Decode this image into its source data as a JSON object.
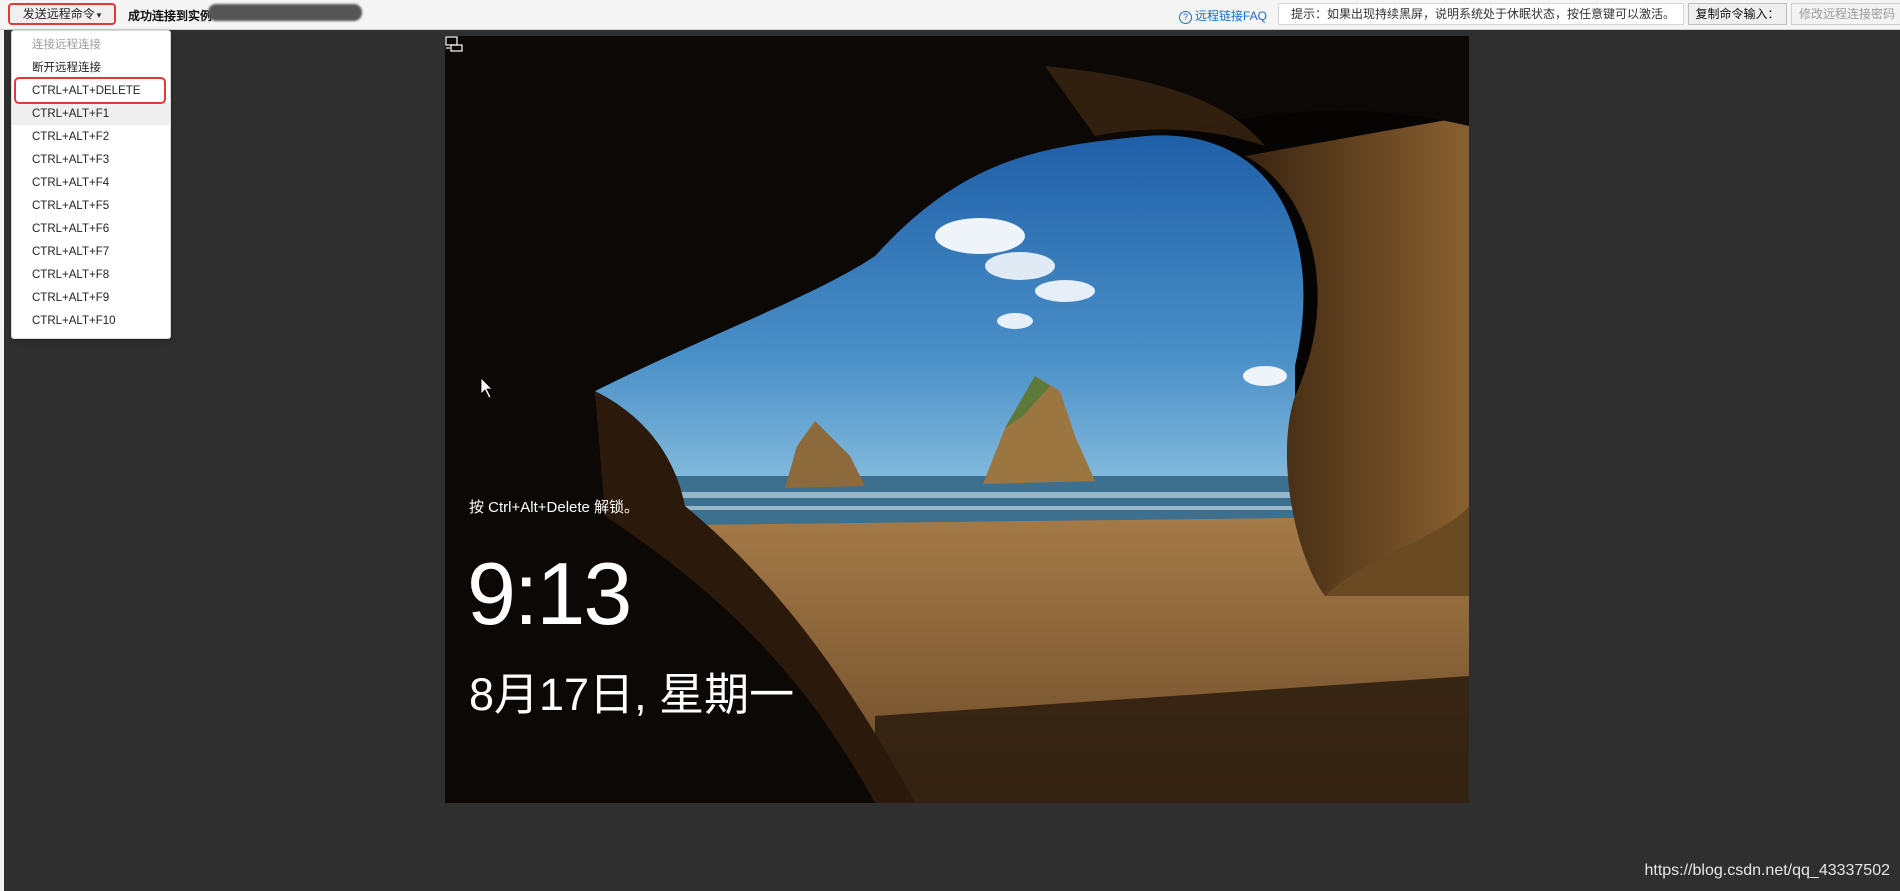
{
  "toolbar": {
    "send_command_label": "发送远程命令",
    "status_text": "成功连接到实例",
    "faq_link": "远程链接FAQ",
    "hint_text": "提示：如果出现持续黑屏，说明系统处于休眠状态，按任意键可以激活。",
    "copy_command_label": "复制命令输入：",
    "modify_password_label": "修改远程连接密码"
  },
  "menu": {
    "items": [
      {
        "label": "连接远程连接",
        "enabled": false
      },
      {
        "label": "断开远程连接",
        "enabled": true
      },
      {
        "label": "CTRL+ALT+DELETE",
        "enabled": true,
        "highlighted": true
      },
      {
        "label": "CTRL+ALT+F1",
        "enabled": true
      },
      {
        "label": "CTRL+ALT+F2",
        "enabled": true
      },
      {
        "label": "CTRL+ALT+F3",
        "enabled": true
      },
      {
        "label": "CTRL+ALT+F4",
        "enabled": true
      },
      {
        "label": "CTRL+ALT+F5",
        "enabled": true
      },
      {
        "label": "CTRL+ALT+F6",
        "enabled": true
      },
      {
        "label": "CTRL+ALT+F7",
        "enabled": true
      },
      {
        "label": "CTRL+ALT+F8",
        "enabled": true
      },
      {
        "label": "CTRL+ALT+F9",
        "enabled": true
      },
      {
        "label": "CTRL+ALT+F10",
        "enabled": true
      }
    ]
  },
  "lockscreen": {
    "hint": "按 Ctrl+Alt+Delete 解锁。",
    "time": "9:13",
    "date": "8月17日, 星期一"
  },
  "watermark": "https://blog.csdn.net/qq_43337502",
  "colors": {
    "accent_red": "#e53935",
    "link_blue": "#1a6ccc",
    "page_bg": "#2f2f2f"
  }
}
